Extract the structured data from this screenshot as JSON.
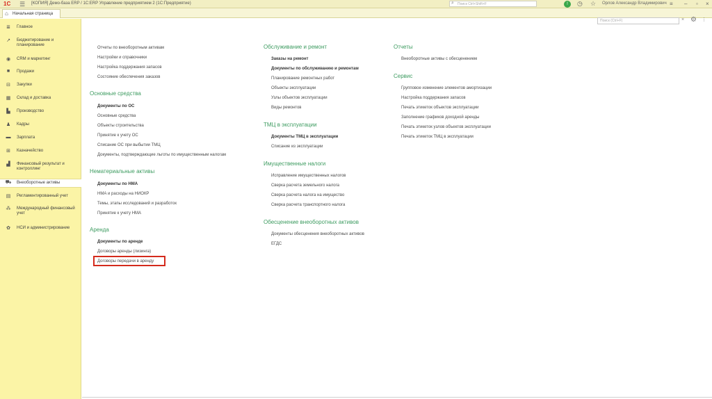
{
  "titlebar": {
    "logo": "1С",
    "window_title": "[КОПИЯ] Демо-база ERP / 1С:ERP Управление предприятием 2  (1С:Предприятие)",
    "search_placeholder": "Поиск Ctrl+Shift+F",
    "user": "Орлов Александр Владимирович"
  },
  "tabs": {
    "home_label": "Начальная страница"
  },
  "sidebar": {
    "items": [
      {
        "label": "Главное",
        "icon": "menu-lines-icon"
      },
      {
        "label": "Бюджетирование и планирование",
        "icon": "chart-icon"
      },
      {
        "label": "CRM и маркетинг",
        "icon": "crm-icon"
      },
      {
        "label": "Продажи",
        "icon": "bag-icon"
      },
      {
        "label": "Закупки",
        "icon": "cart-icon"
      },
      {
        "label": "Склад и доставка",
        "icon": "warehouse-icon"
      },
      {
        "label": "Производство",
        "icon": "factory-icon"
      },
      {
        "label": "Кадры",
        "icon": "person-icon"
      },
      {
        "label": "Зарплата",
        "icon": "wallet-icon"
      },
      {
        "label": "Казначейство",
        "icon": "treasury-icon"
      },
      {
        "label": "Финансовый результат и контроллинг",
        "icon": "finance-icon"
      },
      {
        "label": "Внеоборотные активы",
        "icon": "car-icon"
      },
      {
        "label": "Регламентированный учет",
        "icon": "book-icon"
      },
      {
        "label": "Международный финансовый учет",
        "icon": "globe-icon"
      },
      {
        "label": "НСИ и администрирование",
        "icon": "gear-icon"
      }
    ]
  },
  "main": {
    "search_placeholder": "Поиск (Ctrl+F)",
    "col1": {
      "top_links": [
        "Отчеты по внеоборотным активам",
        "Настройки и справочники",
        "Настройка поддержания запасов",
        "Состояние обеспечения заказов"
      ],
      "os_header": "Основные средства",
      "os_links": [
        "Документы по ОС",
        "Основные средства",
        "Объекты строительства",
        "Принятие к учету ОС",
        "Списание ОС при выбытии ТМЦ",
        "Документы, подтверждающие льготы по имущественным налогам"
      ],
      "nma_header": "Нематериальные активы",
      "nma_links": [
        "Документы по НМА",
        "НМА и расходы на НИОКР",
        "Темы, этапы исследований и разработок",
        "Принятие к учету НМА"
      ],
      "arenda_header": "Аренда",
      "arenda_links": [
        "Документы по аренде",
        "Договоры аренды (лизинга)",
        "Договоры передачи в аренду"
      ]
    },
    "col2": {
      "obs_header": "Обслуживание и ремонт",
      "obs_links": [
        "Заказы на ремонт",
        "Документы по обслуживанию и ремонтам",
        "Планирование ремонтных работ",
        "Объекты эксплуатации",
        "Узлы объектов эксплуатации",
        "Виды ремонтов"
      ],
      "tmc_header": "ТМЦ в эксплуатации",
      "tmc_links": [
        "Документы ТМЦ в эксплуатации",
        "Списание из эксплуатации"
      ],
      "tax_header": "Имущественные налоги",
      "tax_links": [
        "Исправление имущественных налогов",
        "Сверка расчета земельного налога",
        "Сверка расчета налога на имущество",
        "Сверка расчета транспортного налога"
      ],
      "obsp_header": "Обесценение внеоборотных активов",
      "obsp_links": [
        "Документы обесценения внеоборотных активов",
        "ЕГДС"
      ]
    },
    "col3": {
      "reports_header": "Отчеты",
      "reports_links": [
        "Внеоборотные активы с обесценением"
      ],
      "service_header": "Сервис",
      "service_links": [
        "Групповое изменение элементов амортизации",
        "Настройка поддержания запасов",
        "Печать этикеток объектов эксплуатации",
        "Заполнение графиков доходной аренды",
        "Печать этикеток узлов объектов эксплуатации",
        "Печать этикеток ТМЦ в эксплуатации"
      ]
    }
  }
}
